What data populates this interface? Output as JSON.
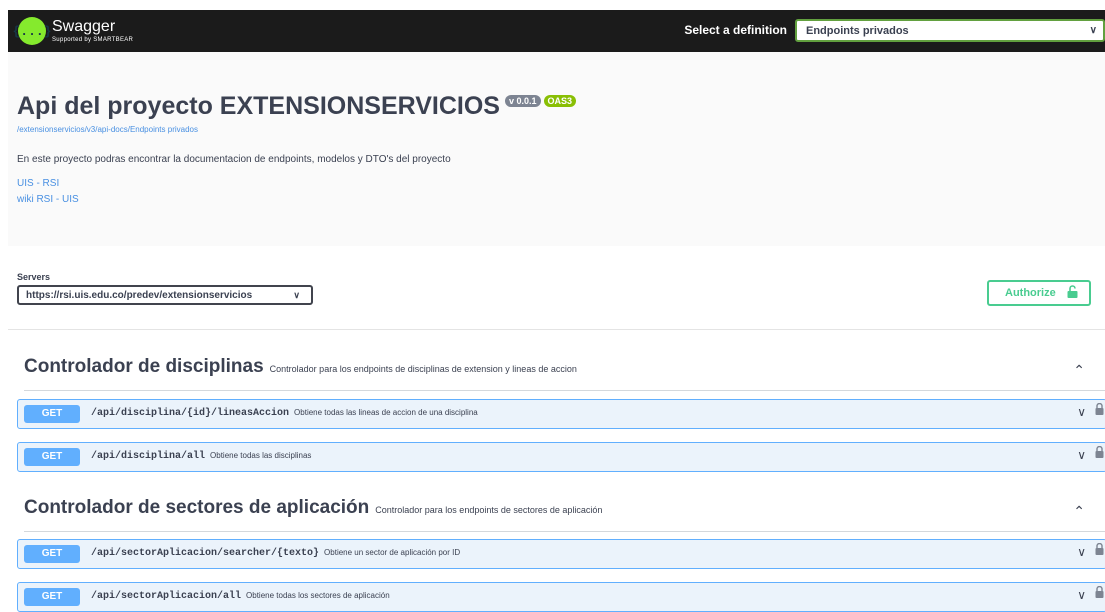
{
  "topbar": {
    "logo_icon": "{...}",
    "logo_title": "Swagger",
    "logo_subtitle": "Supported by SMARTBEAR",
    "definition_label": "Select a definition",
    "definition_value": "Endpoints privados"
  },
  "info": {
    "title": "Api del proyecto EXTENSIONSERVICIOS",
    "version_badge": "v 0.0.1",
    "oas_badge": "OAS3",
    "url": "/extensionservicios/v3/api-docs/Endpoints privados",
    "description": "En este proyecto podras encontrar la documentacion de endpoints, modelos y DTO's del proyecto",
    "links": [
      "UIS - RSI",
      "wiki RSI - UIS"
    ]
  },
  "servers": {
    "label": "Servers",
    "selected": "https://rsi.uis.edu.co/predev/extensionservicios"
  },
  "authorize_label": "Authorize",
  "colors": {
    "get": "#61affe",
    "authorize": "#49cc90",
    "oas": "#89bf04",
    "logo": "#85ea2d"
  },
  "tags": [
    {
      "name": "Controlador de disciplinas",
      "description": "Controlador para los endpoints de disciplinas de extension y lineas de accion",
      "operations": [
        {
          "method": "GET",
          "path": "/api/disciplina/{id}/lineasAccion",
          "summary": "Obtiene todas las lineas de accion de una disciplina"
        },
        {
          "method": "GET",
          "path": "/api/disciplina/all",
          "summary": "Obtiene todas las disciplinas"
        }
      ]
    },
    {
      "name": "Controlador de sectores de aplicación",
      "description": "Controlador para los endpoints de sectores de aplicación",
      "operations": [
        {
          "method": "GET",
          "path": "/api/sectorAplicacion/searcher/{texto}",
          "summary": "Obtiene un sector de aplicación por ID"
        },
        {
          "method": "GET",
          "path": "/api/sectorAplicacion/all",
          "summary": "Obtiene todas los sectores de aplicación"
        }
      ]
    }
  ]
}
